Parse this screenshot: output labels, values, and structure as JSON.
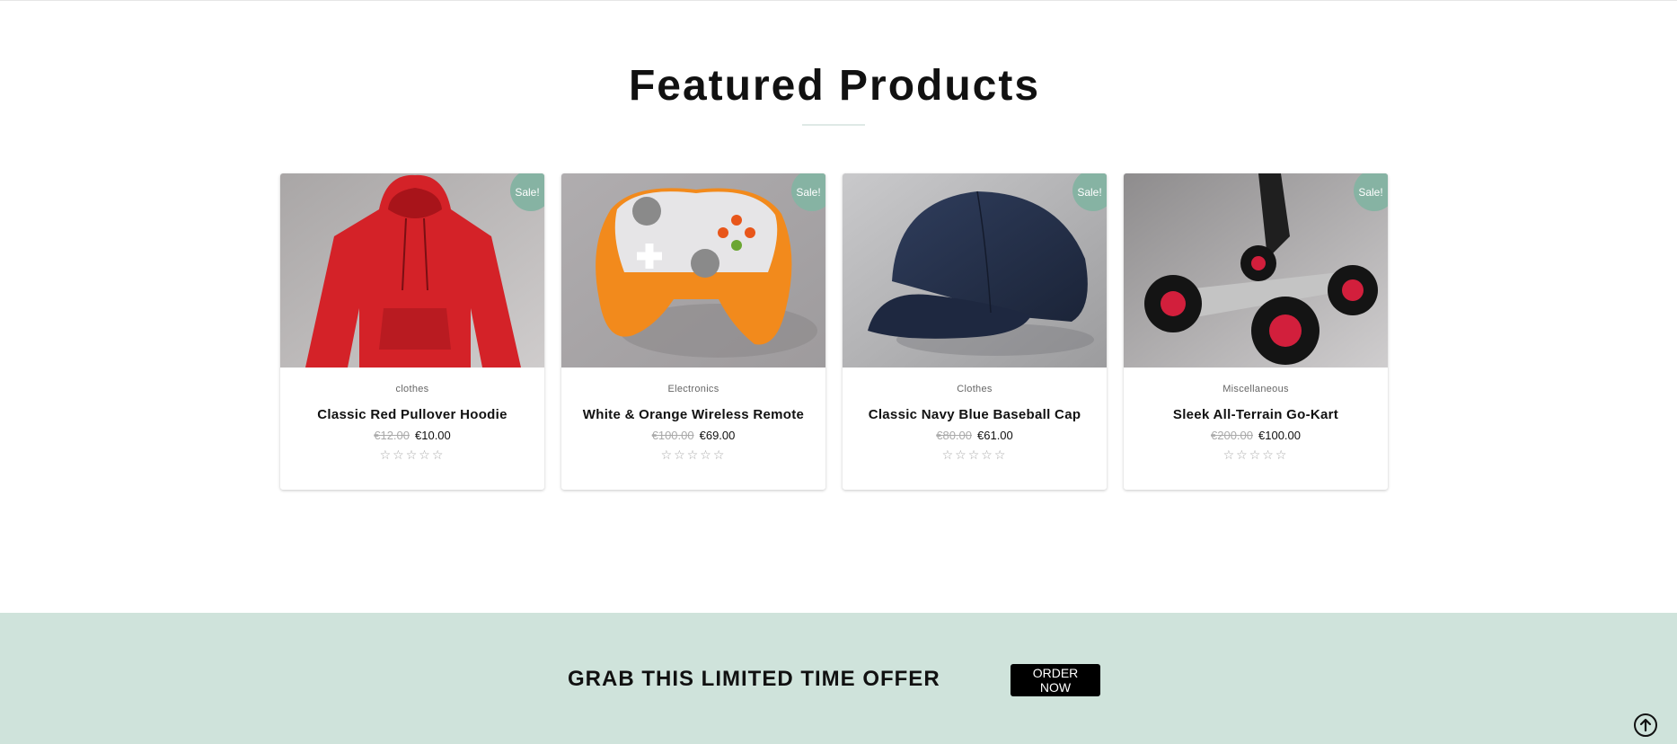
{
  "featured": {
    "title": "Featured Products",
    "products": [
      {
        "badge": "Sale!",
        "category": "clothes",
        "name": "Classic Red Pullover Hoodie",
        "old_price": "€12.00",
        "price": "€10.00",
        "rating_stars": "☆☆☆☆☆",
        "image": "red-hoodie"
      },
      {
        "badge": "Sale!",
        "category": "Electronics",
        "name": "White & Orange Wireless Remote",
        "old_price": "€100.00",
        "price": "€69.00",
        "rating_stars": "☆☆☆☆☆",
        "image": "game-controller"
      },
      {
        "badge": "Sale!",
        "category": "Clothes",
        "name": "Classic Navy Blue Baseball Cap",
        "old_price": "€80.00",
        "price": "€61.00",
        "rating_stars": "☆☆☆☆☆",
        "image": "navy-cap"
      },
      {
        "badge": "Sale!",
        "category": "Miscellaneous",
        "name": "Sleek All-Terrain Go-Kart",
        "old_price": "€200.00",
        "price": "€100.00",
        "rating_stars": "☆☆☆☆☆",
        "image": "go-kart"
      }
    ]
  },
  "offer": {
    "text": "GRAB THIS LIMITED TIME OFFER",
    "button_label": "ORDER NOW"
  },
  "icons": {
    "scroll_top": "arrow-up-circle-icon",
    "rating": "star-outline-icon"
  },
  "colors": {
    "sale_badge": "#86b3a3",
    "offer_band": "#cfe3db",
    "button": "#000000"
  }
}
